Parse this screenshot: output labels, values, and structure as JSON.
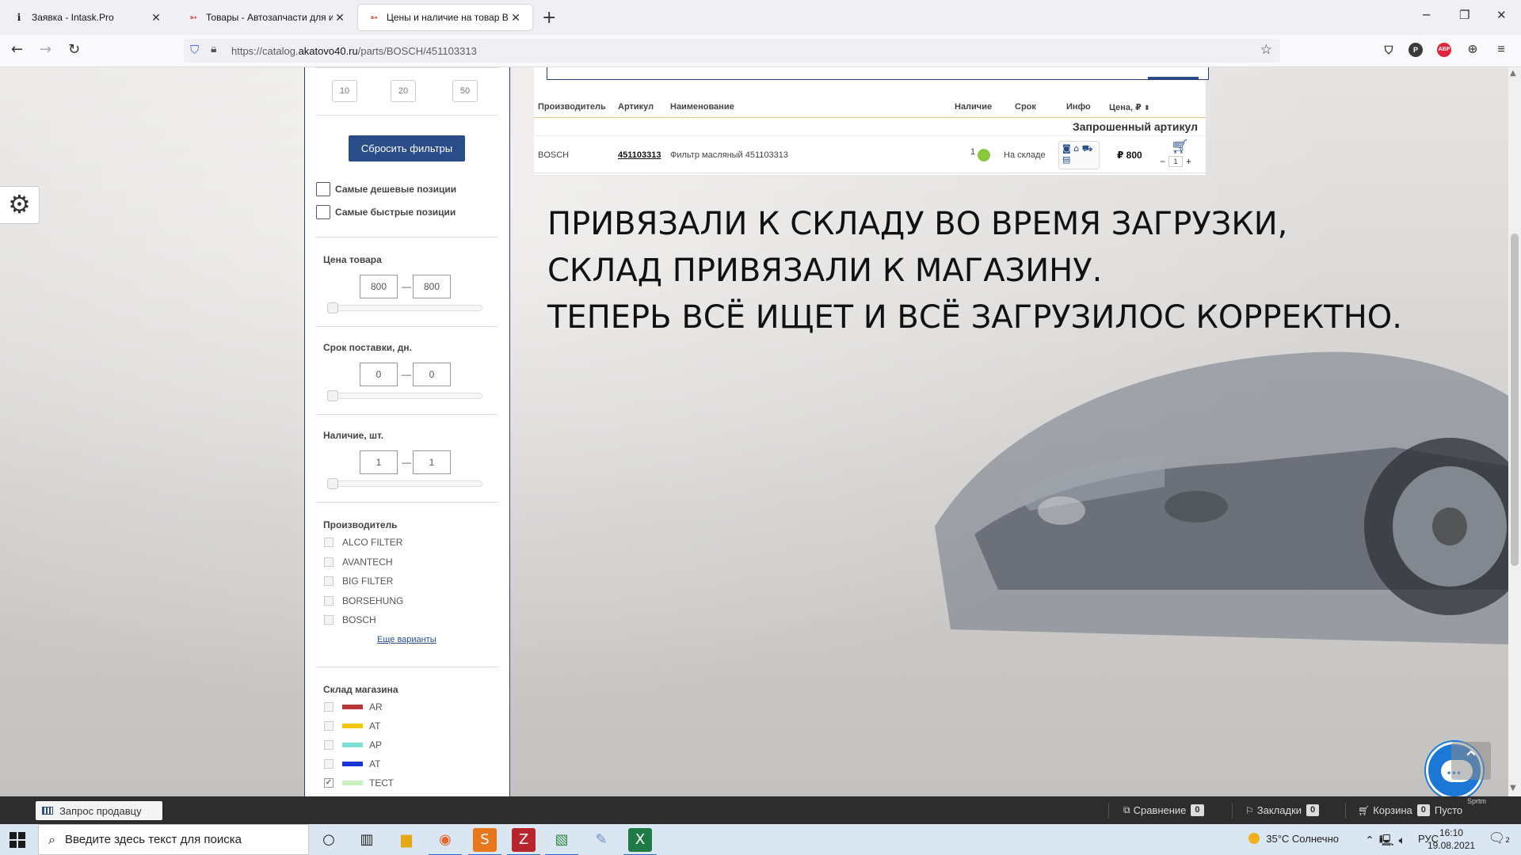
{
  "browser": {
    "tabs": [
      {
        "title": "Заявка - Intask.Pro",
        "favicon": "i"
      },
      {
        "title": "Товары - Автозапчасти для ин",
        "favicon": "car-red"
      },
      {
        "title": "Цены и наличие на товар BOS",
        "favicon": "car-red"
      }
    ],
    "url_prefix": "https://catalog.",
    "url_domain": "akatovo40.ru",
    "url_path": "/parts/BOSCH/451103313",
    "extensions": [
      "pocket-icon",
      "profile-p",
      "adblock-abp",
      "translate-icon"
    ],
    "ext_p_label": "P",
    "ext_abp_label": "ABP"
  },
  "sidebar": {
    "qty_buttons": [
      "10",
      "20",
      "50"
    ],
    "reset_label": "Сбросить фильтры",
    "cheapest_label": "Самые дешевые позиции",
    "fastest_label": "Самые быстрые позиции",
    "price": {
      "title": "Цена товара",
      "min": "800",
      "max": "800"
    },
    "delivery": {
      "title": "Срок поставки, дн.",
      "min": "0",
      "max": "0"
    },
    "stock": {
      "title": "Наличие, шт.",
      "min": "1",
      "max": "1"
    },
    "range_dash": "—",
    "manufacturer_title": "Производитель",
    "manufacturers": [
      "ALCO FILTER",
      "AVANTECH",
      "BIG FILTER",
      "BORSEHUNG",
      "BOSCH"
    ],
    "more_label": "Еще варианты",
    "warehouse_title": "Склад магазина",
    "warehouses": [
      {
        "name": "AR",
        "color": "#b8373a",
        "checked": false
      },
      {
        "name": "AT",
        "color": "#f2c80f",
        "checked": false
      },
      {
        "name": "AP",
        "color": "#7fe0d4",
        "checked": false
      },
      {
        "name": "AT",
        "color": "#1836d8",
        "checked": false
      },
      {
        "name": "ТЕСТ",
        "color": "#c8f0c0",
        "checked": true
      }
    ]
  },
  "table": {
    "headers": {
      "manufacturer": "Производитель",
      "article": "Артикул",
      "name": "Наименование",
      "availability": "Наличие",
      "term": "Срок",
      "info": "Инфо",
      "price": "Цена, ₽"
    },
    "requested_label": "Запрошенный артикул",
    "row": {
      "manufacturer": "BOSCH",
      "article": "451103313",
      "name": "Фильтр масляный 451103313",
      "availability": "1",
      "term": "На складе",
      "price": "₽ 800",
      "qty": "1"
    }
  },
  "annotation": [
    "ПРИВЯЗАЛИ К СКЛАДУ ВО ВРЕМЯ ЗАГРУЗКИ,",
    "СКЛАД ПРИВЯЗАЛИ К МАГАЗИНУ.",
    "ТЕПЕРЬ ВСЁ ИЩЕТ И ВСЁ ЗАГРУЗИЛОС КОРРЕКТНО."
  ],
  "bottom_bar": {
    "seller_label": "Запрос продавцу",
    "compare_label": "Сравнение",
    "compare_count": "0",
    "bookmarks_label": "Закладки",
    "bookmarks_count": "0",
    "cart_label": "Корзина",
    "cart_count": "0",
    "cart_status": "Пусто",
    "cart_brand": "Sprtm"
  },
  "taskbar": {
    "search_placeholder": "Введите здесь текст для поиска",
    "weather": "35°C  Солнечно",
    "lang": "РУС",
    "time": "16:10",
    "date": "19.08.2021",
    "notif_count": "2"
  }
}
